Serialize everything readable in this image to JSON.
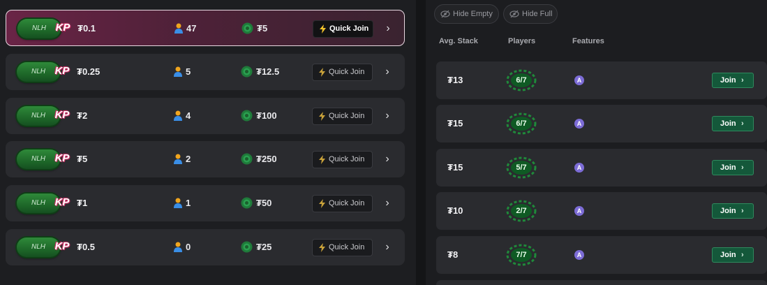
{
  "currency_symbol": "₮",
  "stake_rows": [
    {
      "game": "NLH",
      "brand": "KP",
      "stake": "₮0.1",
      "players": "47",
      "buyin": "₮5",
      "quick_join": "Quick Join",
      "selected": true
    },
    {
      "game": "NLH",
      "brand": "KP",
      "stake": "₮0.25",
      "players": "5",
      "buyin": "₮12.5",
      "quick_join": "Quick Join",
      "selected": false
    },
    {
      "game": "NLH",
      "brand": "KP",
      "stake": "₮2",
      "players": "4",
      "buyin": "₮100",
      "quick_join": "Quick Join",
      "selected": false
    },
    {
      "game": "NLH",
      "brand": "KP",
      "stake": "₮5",
      "players": "2",
      "buyin": "₮250",
      "quick_join": "Quick Join",
      "selected": false
    },
    {
      "game": "NLH",
      "brand": "KP",
      "stake": "₮1",
      "players": "1",
      "buyin": "₮50",
      "quick_join": "Quick Join",
      "selected": false
    },
    {
      "game": "NLH",
      "brand": "KP",
      "stake": "₮0.5",
      "players": "0",
      "buyin": "₮25",
      "quick_join": "Quick Join",
      "selected": false
    }
  ],
  "filters": {
    "hide_empty": "Hide Empty",
    "hide_full": "Hide Full"
  },
  "table_headers": {
    "avg_stack": "Avg. Stack",
    "players": "Players",
    "features": "Features"
  },
  "tables": [
    {
      "avg_stack": "₮13",
      "seats": "6/7",
      "feature": "A",
      "join": "Join"
    },
    {
      "avg_stack": "₮15",
      "seats": "6/7",
      "feature": "A",
      "join": "Join"
    },
    {
      "avg_stack": "₮15",
      "seats": "5/7",
      "feature": "A",
      "join": "Join"
    },
    {
      "avg_stack": "₮10",
      "seats": "2/7",
      "feature": "A",
      "join": "Join"
    },
    {
      "avg_stack": "₮8",
      "seats": "7/7",
      "feature": "A",
      "join": "Join"
    }
  ],
  "colors": {
    "selected_row": "#6a2446",
    "join_green": "#14583a",
    "feature_purple": "#7c6cd6",
    "chip_green": "#1f7a3a"
  }
}
